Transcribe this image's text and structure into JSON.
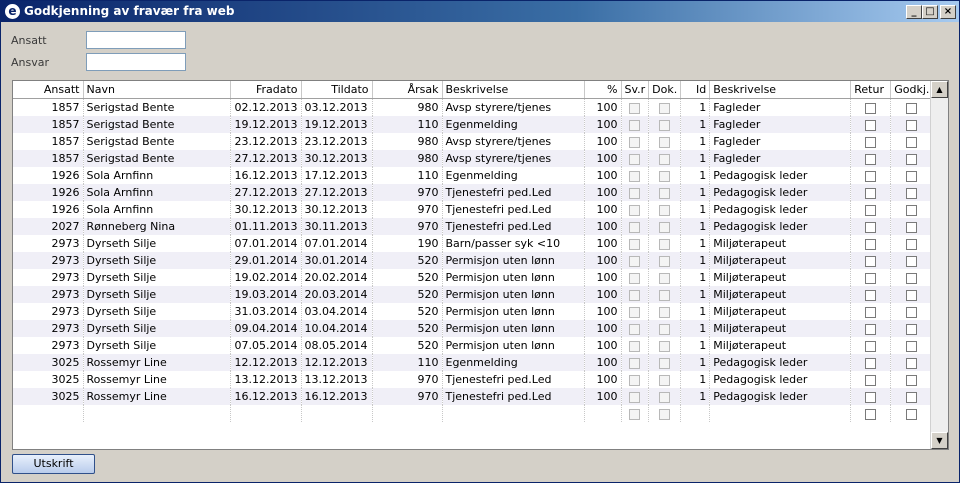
{
  "window": {
    "title": "Godkjenning av fravær fra web"
  },
  "filters": {
    "ansatt_label": "Ansatt",
    "ansatt_value": "",
    "ansvar_label": "Ansvar",
    "ansvar_value": ""
  },
  "table": {
    "headers": [
      "Ansatt",
      "Navn",
      "Fradato",
      "Tildato",
      "Årsak",
      "Beskrivelse",
      "%",
      "Sv.r",
      "Dok.",
      "Id",
      "Beskrivelse",
      "Retur",
      "Godkj."
    ],
    "rows": [
      [
        "1857",
        "Serigstad Bente",
        "02.12.2013",
        "03.12.2013",
        "980",
        "Avsp styrere/tjenes",
        "100",
        "1",
        "Fagleder"
      ],
      [
        "1857",
        "Serigstad Bente",
        "19.12.2013",
        "19.12.2013",
        "110",
        "Egenmelding",
        "100",
        "1",
        "Fagleder"
      ],
      [
        "1857",
        "Serigstad Bente",
        "23.12.2013",
        "23.12.2013",
        "980",
        "Avsp styrere/tjenes",
        "100",
        "1",
        "Fagleder"
      ],
      [
        "1857",
        "Serigstad Bente",
        "27.12.2013",
        "30.12.2013",
        "980",
        "Avsp styrere/tjenes",
        "100",
        "1",
        "Fagleder"
      ],
      [
        "1926",
        "Sola Arnfinn",
        "16.12.2013",
        "17.12.2013",
        "110",
        "Egenmelding",
        "100",
        "1",
        "Pedagogisk leder"
      ],
      [
        "1926",
        "Sola Arnfinn",
        "27.12.2013",
        "27.12.2013",
        "970",
        "Tjenestefri ped.Led",
        "100",
        "1",
        "Pedagogisk leder"
      ],
      [
        "1926",
        "Sola Arnfinn",
        "30.12.2013",
        "30.12.2013",
        "970",
        "Tjenestefri ped.Led",
        "100",
        "1",
        "Pedagogisk leder"
      ],
      [
        "2027",
        "Rønneberg Nina",
        "01.11.2013",
        "30.11.2013",
        "970",
        "Tjenestefri ped.Led",
        "100",
        "1",
        "Pedagogisk leder"
      ],
      [
        "2973",
        "Dyrseth Silje",
        "07.01.2014",
        "07.01.2014",
        "190",
        "Barn/passer syk <10",
        "100",
        "1",
        "Miljøterapeut"
      ],
      [
        "2973",
        "Dyrseth Silje",
        "29.01.2014",
        "30.01.2014",
        "520",
        "Permisjon uten lønn",
        "100",
        "1",
        "Miljøterapeut"
      ],
      [
        "2973",
        "Dyrseth Silje",
        "19.02.2014",
        "20.02.2014",
        "520",
        "Permisjon uten lønn",
        "100",
        "1",
        "Miljøterapeut"
      ],
      [
        "2973",
        "Dyrseth Silje",
        "19.03.2014",
        "20.03.2014",
        "520",
        "Permisjon uten lønn",
        "100",
        "1",
        "Miljøterapeut"
      ],
      [
        "2973",
        "Dyrseth Silje",
        "31.03.2014",
        "03.04.2014",
        "520",
        "Permisjon uten lønn",
        "100",
        "1",
        "Miljøterapeut"
      ],
      [
        "2973",
        "Dyrseth Silje",
        "09.04.2014",
        "10.04.2014",
        "520",
        "Permisjon uten lønn",
        "100",
        "1",
        "Miljøterapeut"
      ],
      [
        "2973",
        "Dyrseth Silje",
        "07.05.2014",
        "08.05.2014",
        "520",
        "Permisjon uten lønn",
        "100",
        "1",
        "Miljøterapeut"
      ],
      [
        "3025",
        "Rossemyr Line",
        "12.12.2013",
        "12.12.2013",
        "110",
        "Egenmelding",
        "100",
        "1",
        "Pedagogisk leder"
      ],
      [
        "3025",
        "Rossemyr Line",
        "13.12.2013",
        "13.12.2013",
        "970",
        "Tjenestefri ped.Led",
        "100",
        "1",
        "Pedagogisk leder"
      ],
      [
        "3025",
        "Rossemyr Line",
        "16.12.2013",
        "16.12.2013",
        "970",
        "Tjenestefri ped.Led",
        "100",
        "1",
        "Pedagogisk leder"
      ]
    ]
  },
  "buttons": {
    "print_label": "Utskrift"
  }
}
